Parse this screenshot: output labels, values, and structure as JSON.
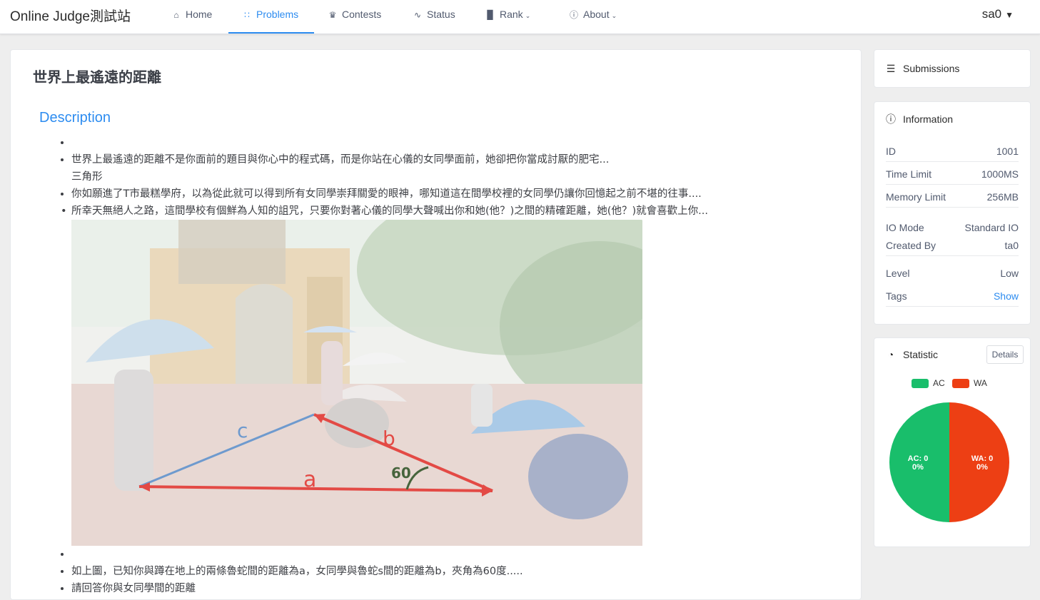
{
  "nav": {
    "brand": "Online Judge測試站",
    "items": [
      {
        "label": "Home",
        "icon": "home-icon"
      },
      {
        "label": "Problems",
        "icon": "grid-icon",
        "active": true
      },
      {
        "label": "Contests",
        "icon": "trophy-icon"
      },
      {
        "label": "Status",
        "icon": "pulse-icon"
      },
      {
        "label": "Rank",
        "icon": "bar-chart-icon",
        "dropdown": true
      },
      {
        "label": "About",
        "icon": "info-icon",
        "dropdown": true
      }
    ],
    "user": "sa0"
  },
  "problem": {
    "title": "世界上最遙遠的距離",
    "description_heading": "Description",
    "lines": [
      "",
      "世界上最遙遠的距離不是你面前的題目與你心中的程式碼，而是你站在心儀的女同學面前，她卻把你當成討厭的肥宅...",
      "三角形",
      "你如願進了T市最糕學府，以為從此就可以得到所有女同學崇拜關愛的眼神，哪知道這在間學校裡的女同學仍讓你回憶起之前不堪的往事....",
      "所幸天無絕人之路，這間學校有個鮮為人知的詛咒，只要你對著心儀的同學大聲喊出你和她(他？)之間的精確距離，她(他？)就會喜歡上你...",
      "",
      "如上圖，已知你與蹲在地上的兩條魯蛇間的距離為a，女同學與魯蛇s間的距離為b，夾角為60度.....",
      "請回答你與女同學間的距離"
    ],
    "figure": {
      "label_a": "a",
      "label_b": "b",
      "label_c": "c",
      "angle_label": "60"
    }
  },
  "sidebar": {
    "submissions_label": "Submissions",
    "info_title": "Information",
    "info": [
      {
        "key": "ID",
        "value": "1001"
      },
      {
        "key": "Time Limit",
        "value": "1000MS"
      },
      {
        "key": "Memory Limit",
        "value": "256MB"
      },
      {
        "key": "IO Mode",
        "value": "Standard IO"
      },
      {
        "key": "Created By",
        "value": "ta0"
      },
      {
        "key": "Level",
        "value": "Low"
      },
      {
        "key": "Tags",
        "value": "Show"
      }
    ],
    "statistic_title": "Statistic",
    "details_label": "Details"
  },
  "colors": {
    "accent": "#2d8cf0",
    "ac": "#19be6b",
    "wa": "#ed3f14"
  },
  "chart_data": {
    "type": "pie",
    "legend": [
      "AC",
      "WA"
    ],
    "slices": [
      {
        "name": "AC",
        "value": 0,
        "label": "AC: 0",
        "pct": "0%"
      },
      {
        "name": "WA",
        "value": 0,
        "label": "WA: 0",
        "pct": "0%"
      }
    ],
    "display_split": [
      0.5,
      0.5
    ],
    "legend_position": "top"
  }
}
